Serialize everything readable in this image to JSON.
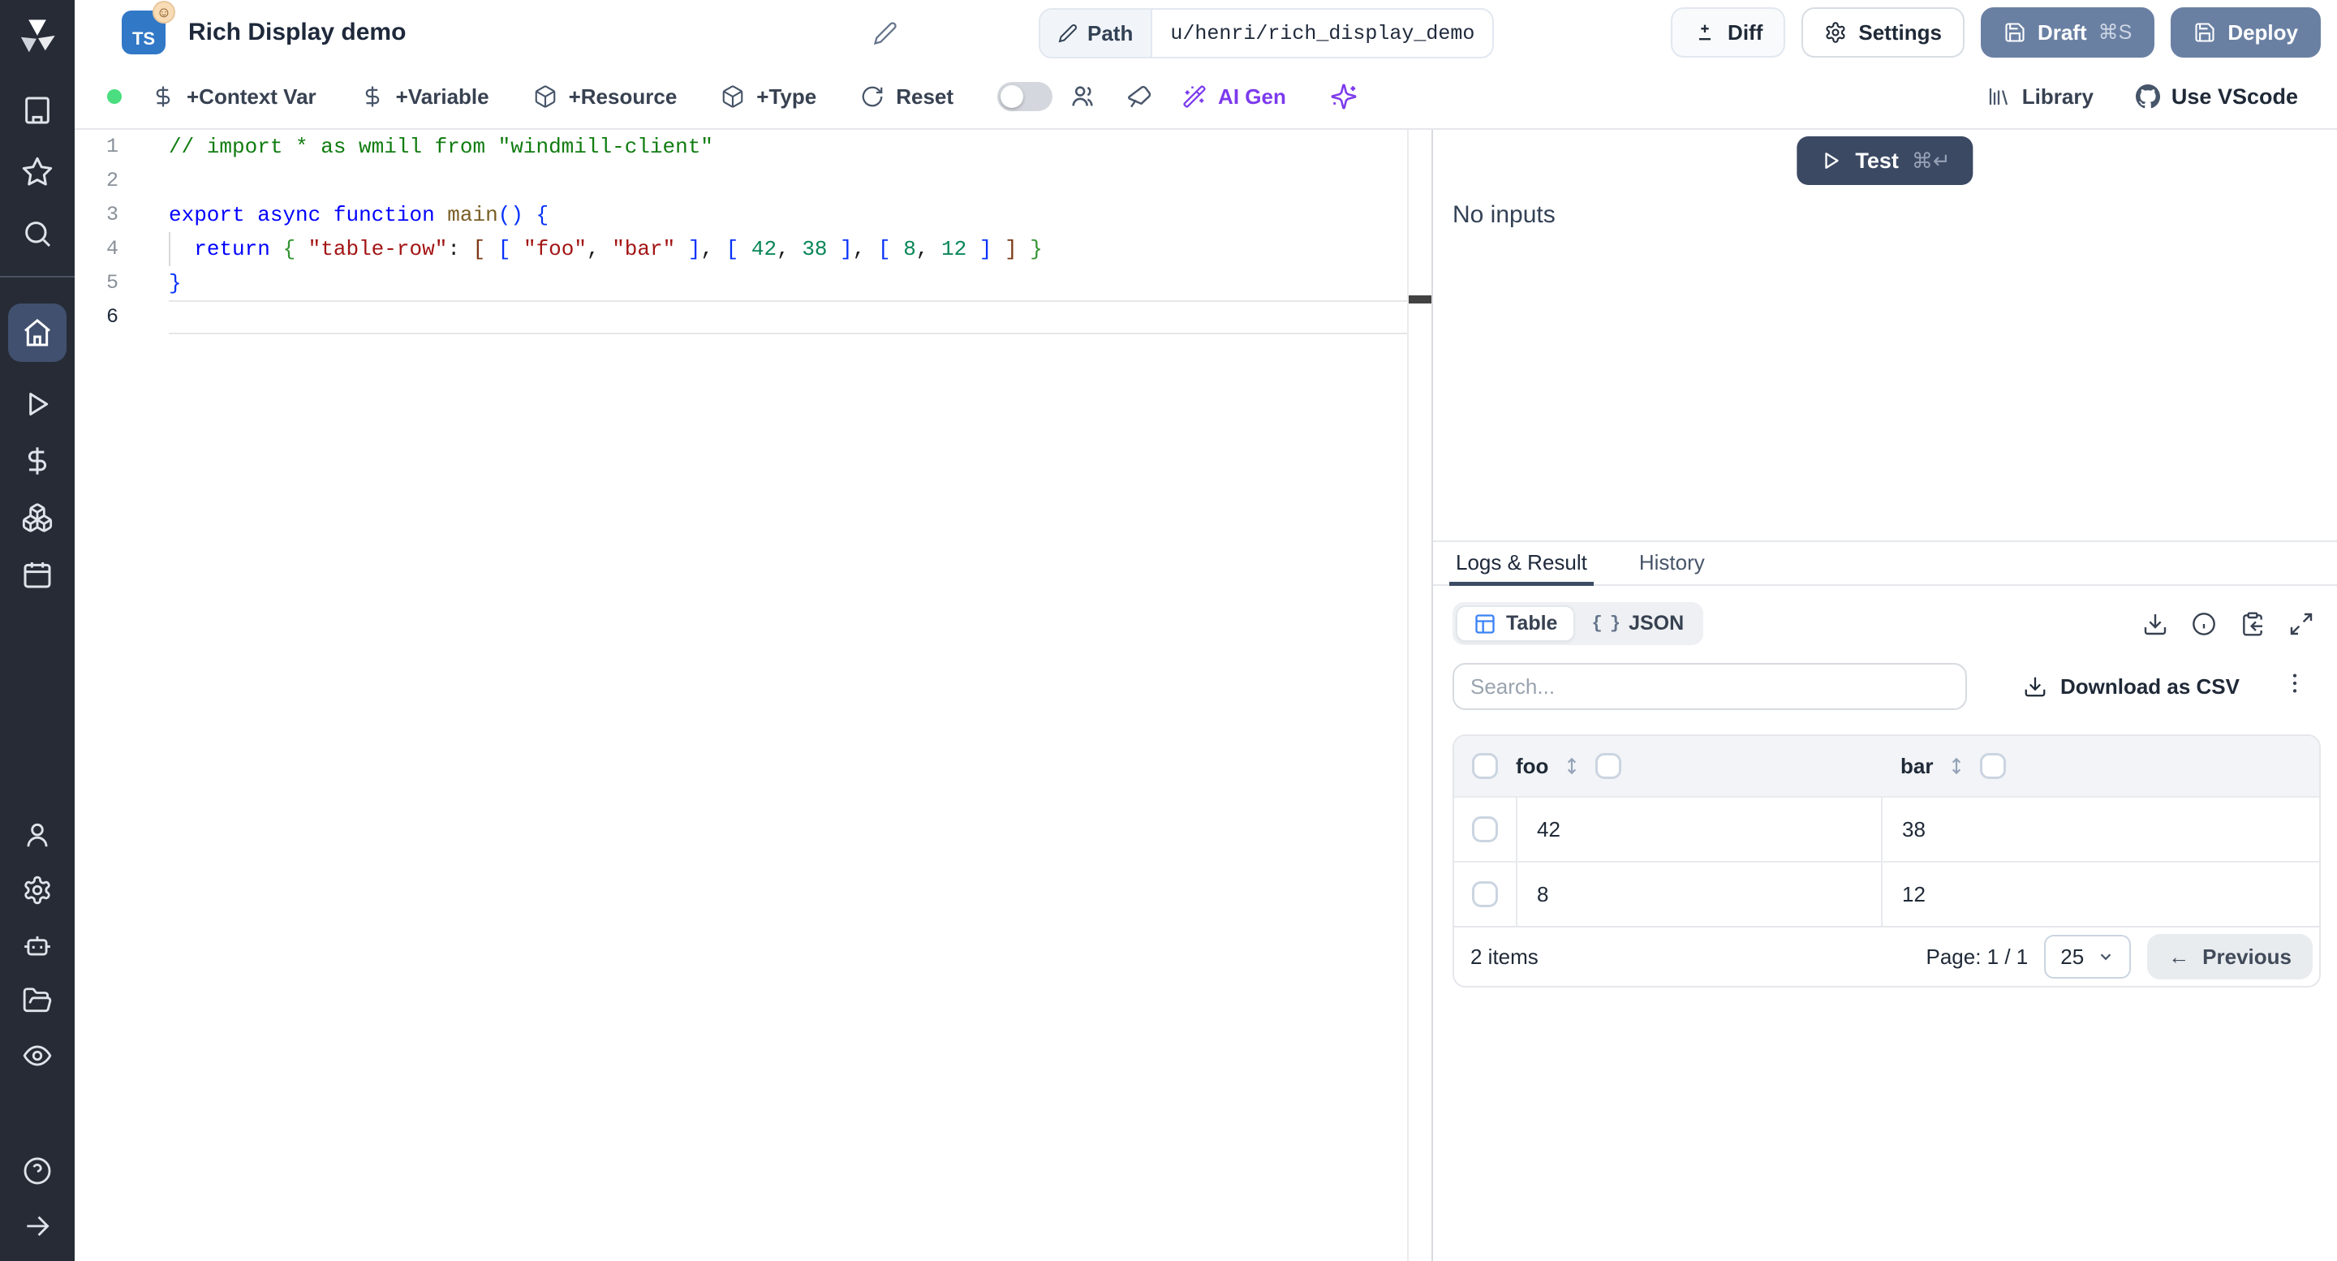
{
  "app": {
    "title": "Rich Display demo",
    "language_badge": "TS",
    "emoji_badge": "☺",
    "path": {
      "label": "Path",
      "value": "u/henri/rich_display_demo"
    }
  },
  "header_buttons": {
    "diff": "Diff",
    "settings": "Settings",
    "draft": "Draft",
    "draft_shortcut": "⌘S",
    "deploy": "Deploy"
  },
  "toolbar": {
    "context_var": "+Context Var",
    "variable": "+Variable",
    "resource": "+Resource",
    "type": "+Type",
    "reset": "Reset",
    "ai_gen": "AI Gen",
    "library": "Library",
    "use_vscode": "Use VScode"
  },
  "editor": {
    "lines": [
      {
        "num": "1",
        "tokens": [
          {
            "t": "// import * as wmill from \"windmill-client\"",
            "c": "cm"
          }
        ]
      },
      {
        "num": "2",
        "tokens": []
      },
      {
        "num": "3",
        "tokens": [
          {
            "t": "export",
            "c": "kw"
          },
          {
            "t": " ",
            "c": "pl"
          },
          {
            "t": "async",
            "c": "kw"
          },
          {
            "t": " ",
            "c": "pl"
          },
          {
            "t": "function",
            "c": "kw"
          },
          {
            "t": " ",
            "c": "pl"
          },
          {
            "t": "main",
            "c": "fn"
          },
          {
            "t": "(",
            "c": "b1"
          },
          {
            "t": ")",
            "c": "b1"
          },
          {
            "t": " ",
            "c": "pl"
          },
          {
            "t": "{",
            "c": "b1"
          }
        ]
      },
      {
        "num": "4",
        "tokens": [
          {
            "t": "  ",
            "c": "pl"
          },
          {
            "t": "return",
            "c": "kw"
          },
          {
            "t": " ",
            "c": "pl"
          },
          {
            "t": "{",
            "c": "b2"
          },
          {
            "t": " ",
            "c": "pl"
          },
          {
            "t": "\"table-row\"",
            "c": "str"
          },
          {
            "t": ":",
            "c": "pl"
          },
          {
            "t": " ",
            "c": "pl"
          },
          {
            "t": "[",
            "c": "b3"
          },
          {
            "t": " ",
            "c": "pl"
          },
          {
            "t": "[",
            "c": "b1"
          },
          {
            "t": " ",
            "c": "pl"
          },
          {
            "t": "\"foo\"",
            "c": "str"
          },
          {
            "t": ",",
            "c": "pl"
          },
          {
            "t": " ",
            "c": "pl"
          },
          {
            "t": "\"bar\"",
            "c": "str"
          },
          {
            "t": " ",
            "c": "pl"
          },
          {
            "t": "]",
            "c": "b1"
          },
          {
            "t": ",",
            "c": "pl"
          },
          {
            "t": " ",
            "c": "pl"
          },
          {
            "t": "[",
            "c": "b1"
          },
          {
            "t": " ",
            "c": "pl"
          },
          {
            "t": "42",
            "c": "num"
          },
          {
            "t": ",",
            "c": "pl"
          },
          {
            "t": " ",
            "c": "pl"
          },
          {
            "t": "38",
            "c": "num"
          },
          {
            "t": " ",
            "c": "pl"
          },
          {
            "t": "]",
            "c": "b1"
          },
          {
            "t": ",",
            "c": "pl"
          },
          {
            "t": " ",
            "c": "pl"
          },
          {
            "t": "[",
            "c": "b1"
          },
          {
            "t": " ",
            "c": "pl"
          },
          {
            "t": "8",
            "c": "num"
          },
          {
            "t": ",",
            "c": "pl"
          },
          {
            "t": " ",
            "c": "pl"
          },
          {
            "t": "12",
            "c": "num"
          },
          {
            "t": " ",
            "c": "pl"
          },
          {
            "t": "]",
            "c": "b1"
          },
          {
            "t": " ",
            "c": "pl"
          },
          {
            "t": "]",
            "c": "b3"
          },
          {
            "t": " ",
            "c": "pl"
          },
          {
            "t": "}",
            "c": "b2"
          }
        ]
      },
      {
        "num": "5",
        "tokens": [
          {
            "t": "}",
            "c": "b1"
          }
        ]
      },
      {
        "num": "6",
        "tokens": [],
        "active": true
      }
    ]
  },
  "run_panel": {
    "test": "Test",
    "test_shortcut": "⌘↵",
    "no_inputs": "No inputs"
  },
  "result_panel": {
    "tabs": {
      "logs": "Logs & Result",
      "history": "History"
    },
    "view_toggle": {
      "table": "Table",
      "json": "JSON",
      "json_icon": "{ }"
    },
    "search_placeholder": "Search...",
    "download_csv": "Download as CSV"
  },
  "table": {
    "columns": [
      "foo",
      "bar"
    ],
    "rows": [
      [
        "42",
        "38"
      ],
      [
        "8",
        "12"
      ]
    ],
    "items_label": "2 items",
    "page_label": "Page: 1 / 1",
    "page_size": "25",
    "previous_label": "Previous",
    "previous_arrow": "←"
  },
  "colors": {
    "sidebar_bg": "#262b36",
    "sidebar_active_tile": "#41506e",
    "slate_button": "#6a80a3",
    "test_button": "#3b4963",
    "ai_purple": "#7c3aed",
    "ts_blue": "#3178c6",
    "status_green_dot": "#4ade80",
    "table_icon_blue": "#3b82f6"
  },
  "sidebar_icons": [
    "windmill-logo",
    "building",
    "star",
    "search",
    "home",
    "play",
    "dollar",
    "boxes",
    "calendar",
    "user",
    "gear",
    "bot",
    "folder-open",
    "eye",
    "help",
    "arrow-right"
  ]
}
